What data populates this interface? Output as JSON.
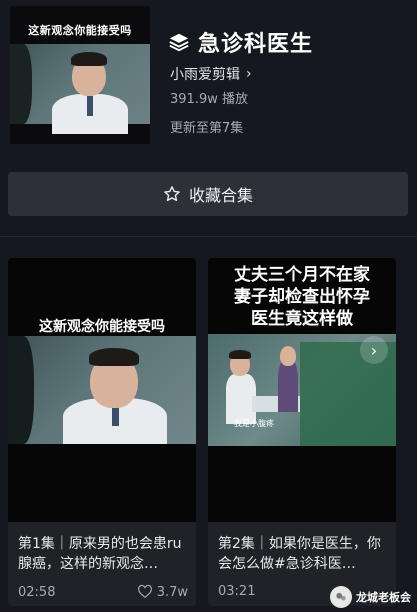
{
  "collection": {
    "cover_caption": "这新观念你能接受吗",
    "title": "急诊科医生",
    "author": "小雨爱剪辑",
    "plays": "391.9w 播放",
    "update_status": "更新至第7集"
  },
  "actions": {
    "collect_label": "收藏合集"
  },
  "episodes": [
    {
      "thumb_caption": "这新观念你能接受吗",
      "title": "第1集｜原来男的也会患ru腺癌，这样的新观念…",
      "duration": "02:58",
      "likes": "3.7w"
    },
    {
      "thumb_caption_lines": [
        "丈夫三个月不在家",
        "妻子却检查出怀孕",
        "医生竟这样做"
      ],
      "scene_caption": "我是小腹疼",
      "title": "第2集｜如果你是医生，你会怎么做#急诊科医…",
      "duration": "03:21"
    }
  ],
  "watermark": {
    "text": "龙城老板会"
  },
  "colors": {
    "background": "#16181f",
    "card": "#202228",
    "button": "#2e3038",
    "muted_text": "#a9abb3"
  }
}
